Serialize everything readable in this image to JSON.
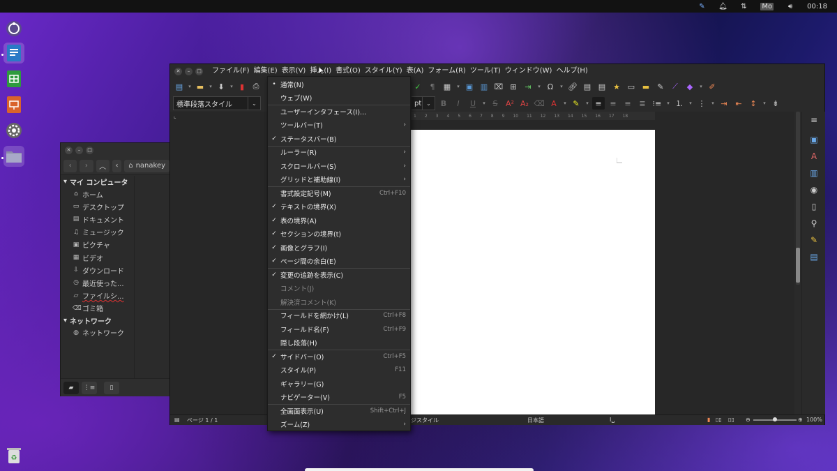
{
  "topbar": {
    "icons": [
      "pen-icon",
      "bell-icon",
      "network-icon",
      "keyboard-layout",
      "volume-icon"
    ],
    "keyboard_label": "Mo",
    "clock": "00:18"
  },
  "dock": {
    "items": [
      "app-launcher",
      "writer",
      "calc",
      "impress",
      "settings",
      "files",
      "trash"
    ]
  },
  "filemanager": {
    "path_label": "nanakey",
    "sections": [
      {
        "title": "マイ コンピュータ",
        "items": [
          {
            "icon": "home-icon",
            "label": "ホーム"
          },
          {
            "icon": "desktop-icon",
            "label": "デスクトップ"
          },
          {
            "icon": "document-icon",
            "label": "ドキュメント"
          },
          {
            "icon": "music-icon",
            "label": "ミュージック"
          },
          {
            "icon": "picture-icon",
            "label": "ピクチャ"
          },
          {
            "icon": "video-icon",
            "label": "ビデオ"
          },
          {
            "icon": "download-icon",
            "label": "ダウンロード"
          },
          {
            "icon": "recent-icon",
            "label": "最近使った..."
          },
          {
            "icon": "filesystem-icon",
            "label": "ファイルシ..."
          },
          {
            "icon": "trash-icon",
            "label": "ゴミ箱"
          }
        ]
      },
      {
        "title": "ネットワーク",
        "items": [
          {
            "icon": "network-icon",
            "label": "ネットワーク"
          }
        ]
      }
    ]
  },
  "writer": {
    "menus": [
      "ファイル(F)",
      "編集(E)",
      "表示(V)",
      "挿入(I)",
      "書式(O)",
      "スタイル(Y)",
      "表(A)",
      "フォーム(R)",
      "ツール(T)",
      "ウィンドウ(W)",
      "ヘルプ(H)"
    ],
    "paragraph_style": "標準段落スタイル",
    "font_size_partial": "pt",
    "status": {
      "page": "ページ 1 / 1",
      "style_partial": "ジスタイル",
      "language": "日本語",
      "zoom": "100%"
    },
    "ruler_ticks": [
      "1",
      "2",
      "3",
      "4",
      "5",
      "6",
      "7",
      "8",
      "9",
      "10",
      "11",
      "12",
      "13",
      "14",
      "15",
      "16",
      "17",
      "18"
    ]
  },
  "view_menu": {
    "items": [
      {
        "label": "通常(N)",
        "check": "•",
        "shortcut": "",
        "submenu": false,
        "disabled": false
      },
      {
        "label": "ウェブ(W)",
        "check": "",
        "shortcut": "",
        "submenu": false,
        "disabled": false
      },
      {
        "sep": true
      },
      {
        "label": "ユーザーインタフェース(I)...",
        "check": "",
        "shortcut": "",
        "submenu": false,
        "disabled": false
      },
      {
        "label": "ツールバー(T)",
        "check": "",
        "shortcut": "",
        "submenu": true,
        "disabled": false
      },
      {
        "label": "ステータスバー(B)",
        "check": "✓",
        "shortcut": "",
        "submenu": false,
        "disabled": false
      },
      {
        "sep": true
      },
      {
        "label": "ルーラー(R)",
        "check": "",
        "shortcut": "",
        "submenu": true,
        "disabled": false
      },
      {
        "label": "スクロールバー(S)",
        "check": "",
        "shortcut": "",
        "submenu": true,
        "disabled": false
      },
      {
        "label": "グリッドと補助線(I)",
        "check": "",
        "shortcut": "",
        "submenu": true,
        "disabled": false
      },
      {
        "sep": true
      },
      {
        "label": "書式設定記号(M)",
        "check": "",
        "shortcut": "Ctrl+F10",
        "submenu": false,
        "disabled": false
      },
      {
        "label": "テキストの境界(X)",
        "check": "✓",
        "shortcut": "",
        "submenu": false,
        "disabled": false
      },
      {
        "label": "表の境界(A)",
        "check": "✓",
        "shortcut": "",
        "submenu": false,
        "disabled": false
      },
      {
        "label": "セクションの境界(t)",
        "check": "✓",
        "shortcut": "",
        "submenu": false,
        "disabled": false
      },
      {
        "label": "画像とグラフ(I)",
        "check": "✓",
        "shortcut": "",
        "submenu": false,
        "disabled": false
      },
      {
        "label": "ページ間の余白(E)",
        "check": "✓",
        "shortcut": "",
        "submenu": false,
        "disabled": false
      },
      {
        "sep": true
      },
      {
        "label": "変更の追跡を表示(C)",
        "check": "✓",
        "shortcut": "",
        "submenu": false,
        "disabled": false
      },
      {
        "label": "コメント(J)",
        "check": "",
        "shortcut": "",
        "submenu": false,
        "disabled": true
      },
      {
        "label": "解決済コメント(K)",
        "check": "",
        "shortcut": "",
        "submenu": false,
        "disabled": true
      },
      {
        "sep": true
      },
      {
        "label": "フィールドを網かけ(L)",
        "check": "",
        "shortcut": "Ctrl+F8",
        "submenu": false,
        "disabled": false
      },
      {
        "label": "フィールド名(F)",
        "check": "",
        "shortcut": "Ctrl+F9",
        "submenu": false,
        "disabled": false
      },
      {
        "label": "隠し段落(H)",
        "check": "",
        "shortcut": "",
        "submenu": false,
        "disabled": false
      },
      {
        "sep": true
      },
      {
        "label": "サイドバー(O)",
        "check": "✓",
        "shortcut": "Ctrl+F5",
        "submenu": false,
        "disabled": false
      },
      {
        "label": "スタイル(P)",
        "check": "",
        "shortcut": "F11",
        "submenu": false,
        "disabled": false
      },
      {
        "label": "ギャラリー(G)",
        "check": "",
        "shortcut": "",
        "submenu": false,
        "disabled": false
      },
      {
        "label": "ナビゲーター(V)",
        "check": "",
        "shortcut": "F5",
        "submenu": false,
        "disabled": false
      },
      {
        "sep": true
      },
      {
        "label": "全画面表示(U)",
        "check": "",
        "shortcut": "Shift+Ctrl+J",
        "submenu": false,
        "disabled": false
      },
      {
        "label": "ズーム(Z)",
        "check": "",
        "shortcut": "",
        "submenu": true,
        "disabled": false
      }
    ]
  }
}
